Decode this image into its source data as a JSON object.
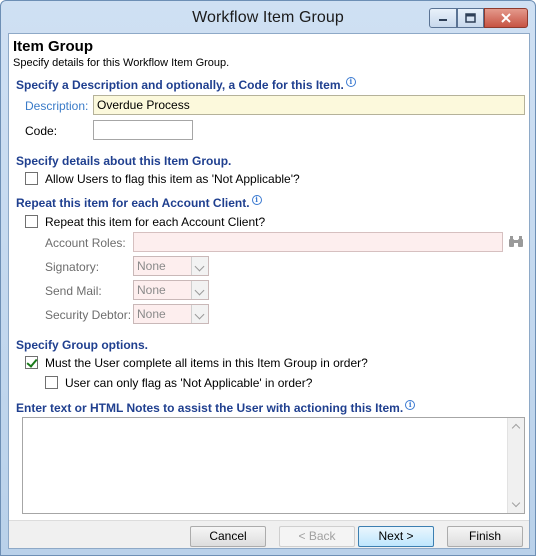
{
  "window": {
    "title": "Workflow Item Group",
    "minimize_icon": "minimize-icon",
    "maximize_icon": "maximize-icon",
    "close_icon": "close-icon"
  },
  "header": {
    "title": "Item Group",
    "subtitle": "Specify details for this Workflow Item Group."
  },
  "description_section": {
    "heading": "Specify a Description and optionally, a Code for this Item.",
    "description_label": "Description:",
    "description_value": "Overdue Process",
    "code_label": "Code:",
    "code_value": ""
  },
  "details_section": {
    "heading": "Specify details about this Item Group.",
    "allow_na_label": "Allow Users to flag this item as 'Not Applicable'?",
    "allow_na_checked": false
  },
  "repeat_section": {
    "heading": "Repeat this item for each Account Client.",
    "repeat_label": "Repeat this item for each Account Client?",
    "repeat_checked": false,
    "account_roles_label": "Account Roles:",
    "account_roles_value": "",
    "signatory_label": "Signatory:",
    "signatory_value": "None",
    "send_mail_label": "Send Mail:",
    "send_mail_value": "None",
    "security_debtor_label": "Security Debtor:",
    "security_debtor_value": "None"
  },
  "group_options": {
    "heading": "Specify Group options.",
    "complete_in_order_label": "Must the User complete all items in this Item Group in order?",
    "complete_in_order_checked": true,
    "na_in_order_label": "User can only flag as 'Not Applicable' in order?",
    "na_in_order_checked": false
  },
  "notes_section": {
    "heading": "Enter text or HTML Notes to assist the User with actioning this Item.",
    "notes_value": ""
  },
  "footer": {
    "cancel": "Cancel",
    "back": "< Back",
    "next": "Next >",
    "finish": "Finish"
  },
  "colors": {
    "section_heading": "#1f3f8f",
    "required_field_bg": "#fcf9dc",
    "disabled_field_bg": "#fdeeee",
    "check_mark": "#1a7a1a"
  }
}
